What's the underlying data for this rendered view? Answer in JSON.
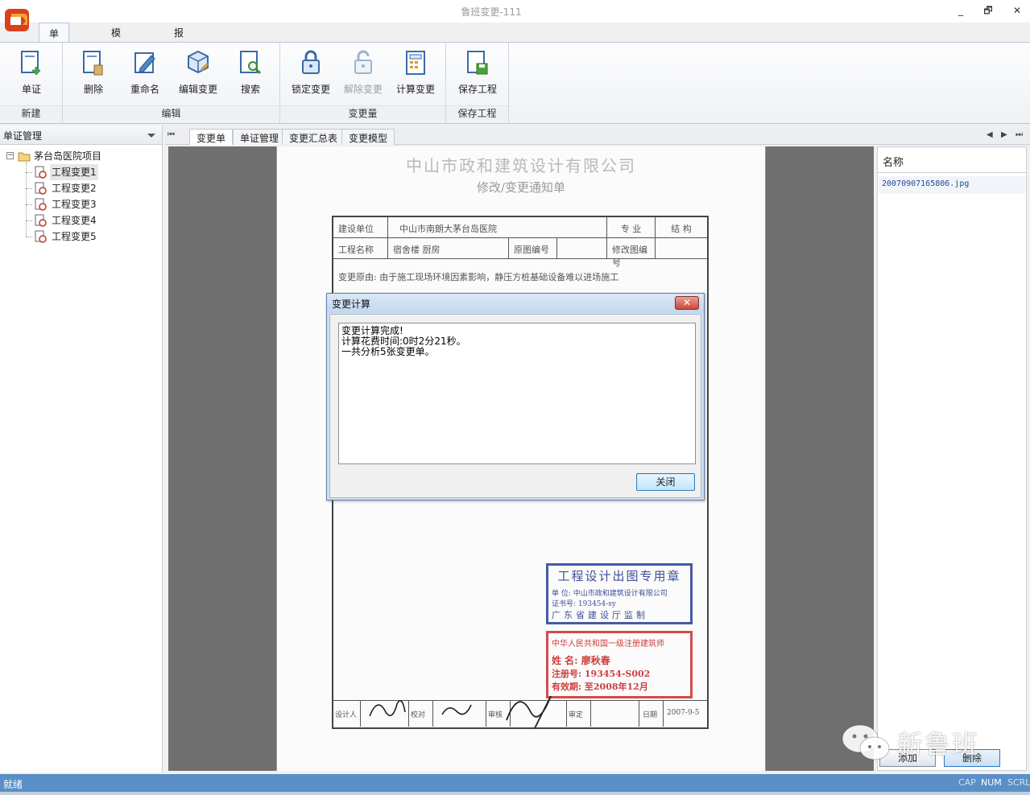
{
  "window": {
    "title": "鲁班变更-111",
    "minimize": "_",
    "restore": "🗗",
    "close": "✕"
  },
  "ribbon": {
    "tabs": [
      "单证管理",
      "模型管理",
      "报表管理"
    ],
    "active_tab": "单证管理",
    "groups": {
      "new": {
        "label": "新建",
        "buttons": [
          "单证"
        ]
      },
      "edit": {
        "label": "编辑",
        "buttons": [
          "删除",
          "重命名",
          "编辑变更",
          "搜索"
        ]
      },
      "amount": {
        "label": "变更量",
        "buttons": [
          "锁定变更",
          "解除变更",
          "计算变更"
        ]
      },
      "save": {
        "label": "保存工程",
        "buttons": [
          "保存工程"
        ]
      }
    }
  },
  "left_panel": {
    "title": "单证管理",
    "project": "茅台岛医院项目",
    "items": [
      "工程变更1",
      "工程变更2",
      "工程变更3",
      "工程变更4",
      "工程变更5"
    ],
    "selected": "工程变更1"
  },
  "doc_tabs": [
    "变更单",
    "单证管理",
    "变更汇总表",
    "变更模型"
  ],
  "document": {
    "company": "中山市政和建筑设计有限公司",
    "subtitle": "修改/变更通知单",
    "row1": {
      "unit_label": "建设单位",
      "unit_value": "中山市南朗大茅台岛医院",
      "major_label": "专  业",
      "major_value": "结  构"
    },
    "row2": {
      "name_label": "工程名称",
      "name_value": "宿舍楼   厨房",
      "orig_label": "原图编号",
      "mod_label": "修改图编号"
    },
    "reason": "变更原由: 由于施工现场环境因素影响，静压方桩基础设备难以进场施工",
    "stamp1": {
      "title": "工程设计出图专用章",
      "l1": "单  位: 中山市政和建筑设计有限公司",
      "l2": "证书号: 193454-sy",
      "l3": "广东省建设厅监制"
    },
    "stamp2": {
      "title": "中华人民共和国一级注册建筑师",
      "l1": "姓  名: 廖秋春",
      "l2": "注册号: 193454-S002",
      "l3": "有效期: 至2008年12月"
    },
    "sign": {
      "designer": "设计人",
      "checker": "校对",
      "reviewer": "审核",
      "approver": "审定",
      "date_label": "日期",
      "date_value": "2007-9-5"
    }
  },
  "right_panel": {
    "header": "名称",
    "files": [
      "20070907165806.jpg"
    ],
    "add_button": "添加",
    "delete_button": "删除"
  },
  "dialog": {
    "title": "变更计算",
    "close_x": "✕",
    "lines": [
      "变更计算完成!",
      "计算花费时间:0时2分21秒。",
      "一共分析5张变更单。"
    ],
    "button": "关闭"
  },
  "statusbar": {
    "status": "就绪",
    "cap": "CAP",
    "num": "NUM",
    "scrl": "SCRL"
  },
  "watermark": {
    "text": "新鲁班"
  },
  "colors": {
    "status_bar": "#5a8fc7",
    "ribbon_border": "#b7c6d9",
    "viewer_bg": "#6f6f6f"
  }
}
